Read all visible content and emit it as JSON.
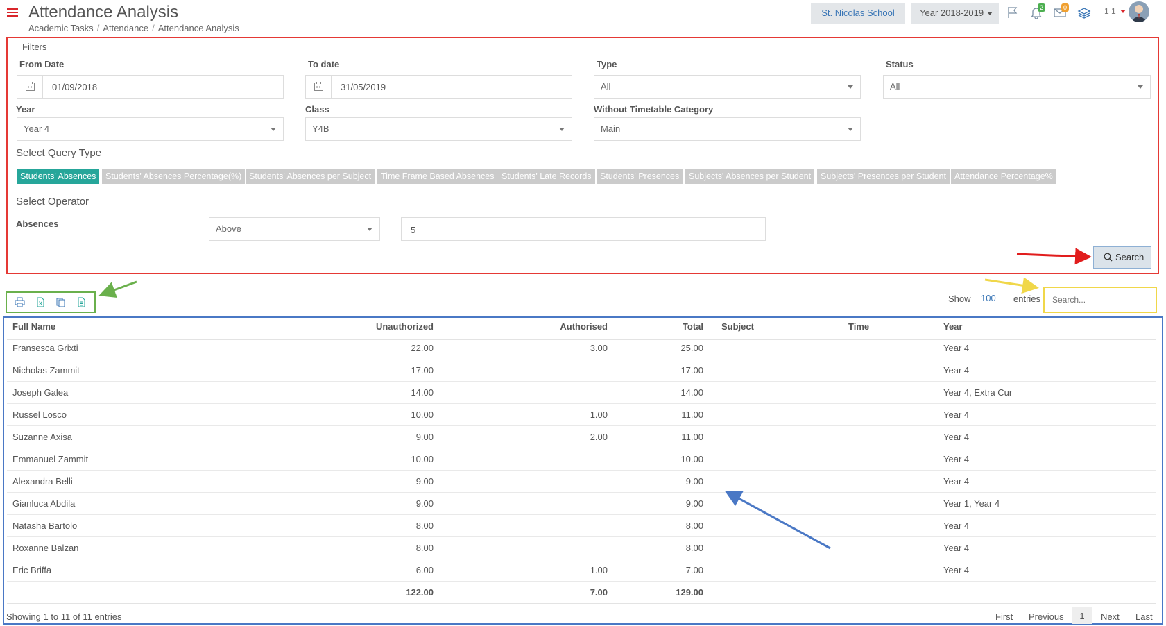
{
  "header": {
    "title": "Attendance Analysis",
    "breadcrumb": [
      "Academic Tasks",
      "Attendance",
      "Attendance Analysis"
    ],
    "school": "St. Nicolas School",
    "year": "Year 2018-2019",
    "notifications_count": "2",
    "messages_count": "0",
    "user_number": "1 1"
  },
  "filters": {
    "legend": "Filters",
    "from_date_label": "From Date",
    "from_date": "01/09/2018",
    "to_date_label": "To date",
    "to_date": "31/05/2019",
    "type_label": "Type",
    "type": "All",
    "status_label": "Status",
    "status": "All",
    "year_label": "Year",
    "year": "Year 4",
    "class_label": "Class",
    "class": "Y4B",
    "category_label": "Without Timetable Category",
    "category": "Main"
  },
  "query": {
    "title": "Select Query Type",
    "types": [
      "Students' Absences",
      "Students' Absences Percentage(%)",
      "Students' Absences per Subject",
      "Time Frame Based Absences",
      "Students' Late Records",
      "Students' Presences",
      "Subjects' Absences per Student",
      "Subjects' Presences per Student",
      "Attendance Percentage%"
    ]
  },
  "operator": {
    "title": "Select Operator",
    "label": "Absences",
    "operator": "Above",
    "value": "5",
    "search_label": "Search"
  },
  "toolbar": {
    "show_label": "Show",
    "show_value": "100",
    "entries_label": "entries",
    "search_placeholder": "Search..."
  },
  "table": {
    "columns": [
      "Full Name",
      "Unauthorized",
      "Authorised",
      "Total",
      "Subject",
      "Time",
      "Year"
    ],
    "rows": [
      [
        "Fransesca Grixti",
        "22.00",
        "3.00",
        "25.00",
        "",
        "",
        "Year 4"
      ],
      [
        "Nicholas Zammit",
        "17.00",
        "",
        "17.00",
        "",
        "",
        "Year 4"
      ],
      [
        "Joseph Galea",
        "14.00",
        "",
        "14.00",
        "",
        "",
        "Year 4, Extra Cur"
      ],
      [
        "Russel Losco",
        "10.00",
        "1.00",
        "11.00",
        "",
        "",
        "Year 4"
      ],
      [
        "Suzanne Axisa",
        "9.00",
        "2.00",
        "11.00",
        "",
        "",
        "Year 4"
      ],
      [
        "Emmanuel Zammit",
        "10.00",
        "",
        "10.00",
        "",
        "",
        "Year 4"
      ],
      [
        "Alexandra Belli",
        "9.00",
        "",
        "9.00",
        "",
        "",
        "Year 4"
      ],
      [
        "Gianluca Abdila",
        "9.00",
        "",
        "9.00",
        "",
        "",
        "Year 1, Year 4"
      ],
      [
        "Natasha Bartolo",
        "8.00",
        "",
        "8.00",
        "",
        "",
        "Year 4"
      ],
      [
        "Roxanne Balzan",
        "8.00",
        "",
        "8.00",
        "",
        "",
        "Year 4"
      ],
      [
        "Eric Briffa",
        "6.00",
        "1.00",
        "7.00",
        "",
        "",
        "Year 4"
      ]
    ],
    "totals": {
      "unauthorized": "122.00",
      "authorised": "7.00",
      "total": "129.00"
    },
    "info": "Showing 1 to 11 of 11 entries",
    "pager": {
      "first": "First",
      "previous": "Previous",
      "current": "1",
      "next": "Next",
      "last": "Last"
    }
  },
  "colors": {
    "accent": "#26a69a",
    "filters_highlight": "#e53935",
    "export_highlight": "#6ab04c",
    "search_highlight": "#f0d74a",
    "table_highlight": "#4a78c5"
  }
}
